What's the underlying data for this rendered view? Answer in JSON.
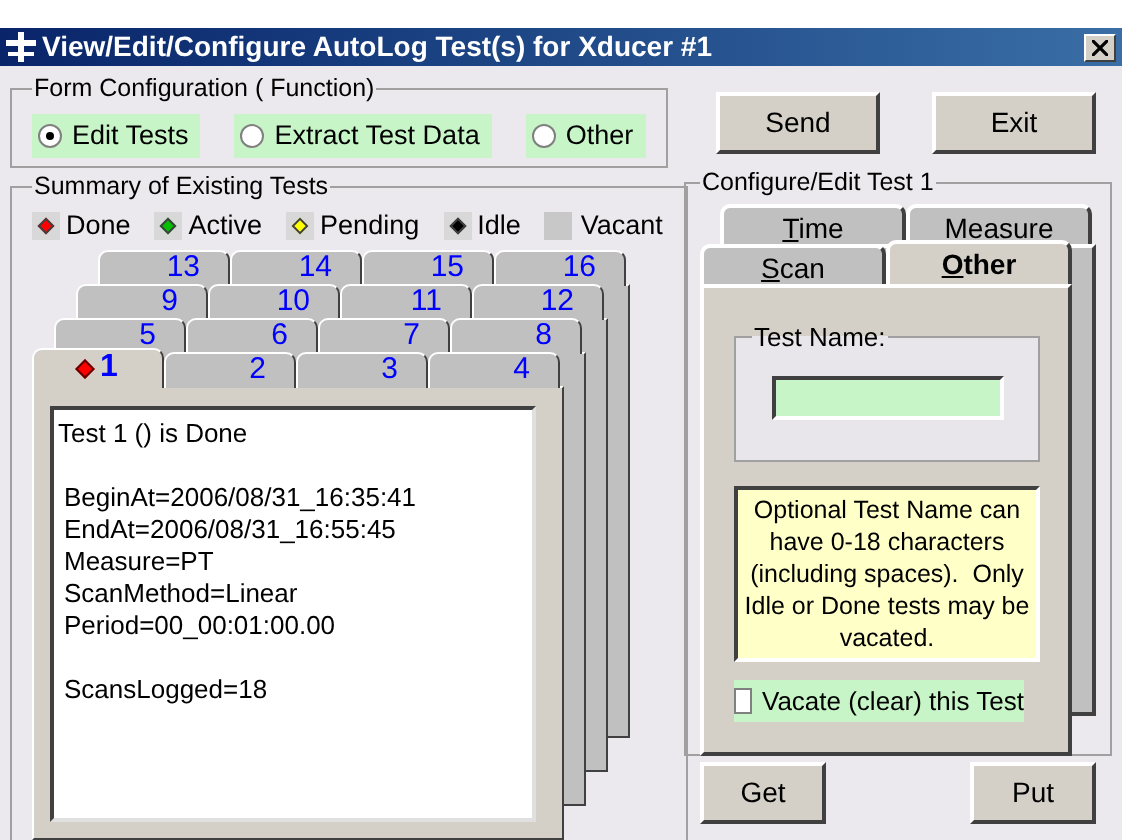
{
  "window": {
    "title": "View/Edit/Configure AutoLog Test(s) for Xducer #1"
  },
  "form_configuration": {
    "title": "Form Configuration ( Function)",
    "options": [
      {
        "label": "Edit Tests",
        "selected": true
      },
      {
        "label": "Extract Test Data",
        "selected": false
      },
      {
        "label": "Other",
        "selected": false
      }
    ]
  },
  "summary": {
    "title": "Summary of Existing Tests",
    "legend": [
      {
        "label": "Done",
        "kind": "diamond",
        "color": "#ff0000"
      },
      {
        "label": "Active",
        "kind": "diamond",
        "color": "#00c000"
      },
      {
        "label": "Pending",
        "kind": "diamond",
        "color": "#ffff00"
      },
      {
        "label": "Idle",
        "kind": "diamond",
        "color": "#000000"
      },
      {
        "label": "Vacant",
        "kind": "square",
        "color": "#c8c8c8"
      }
    ],
    "tab_rows": [
      [
        {
          "label": "13",
          "selected": false
        },
        {
          "label": "14",
          "selected": false
        },
        {
          "label": "15",
          "selected": false
        },
        {
          "label": "16",
          "selected": false
        }
      ],
      [
        {
          "label": "9",
          "selected": false
        },
        {
          "label": "10",
          "selected": false
        },
        {
          "label": "11",
          "selected": false
        },
        {
          "label": "12",
          "selected": false
        }
      ],
      [
        {
          "label": "5",
          "selected": false
        },
        {
          "label": "6",
          "selected": false
        },
        {
          "label": "7",
          "selected": false
        },
        {
          "label": "8",
          "selected": false
        }
      ],
      [
        {
          "label": "1",
          "selected": true,
          "color": "#ff0000"
        },
        {
          "label": "2",
          "selected": false
        },
        {
          "label": "3",
          "selected": false
        },
        {
          "label": "4",
          "selected": false
        }
      ]
    ],
    "details": [
      [
        "Test 1 () is Done"
      ],
      [
        "BeginAt=2006/08/31_16:35:41",
        "EndAt=2006/08/31_16:55:45",
        "Measure=PT",
        "ScanMethod=Linear",
        "Period=00_00:01:00.00"
      ],
      [
        "ScansLogged=18"
      ]
    ]
  },
  "buttons_top": [
    "Send",
    "Exit"
  ],
  "configure": {
    "title": "Configure/Edit Test 1",
    "tab_rows": [
      [
        {
          "label": "Time",
          "selected": false
        },
        {
          "label": "Measure",
          "selected": false
        }
      ],
      [
        {
          "label": "Scan",
          "selected": false
        },
        {
          "label": "Other",
          "selected": true
        }
      ]
    ],
    "test_name": {
      "title": "Test Name:"
    },
    "note": "Optional Test Name can have 0-18 characters (including spaces).  Only Idle or Done tests may be vacated.",
    "vacate": {
      "label": "Vacate (clear) this Test",
      "checked": false
    }
  },
  "buttons_bottom": [
    "Get",
    "Put"
  ]
}
